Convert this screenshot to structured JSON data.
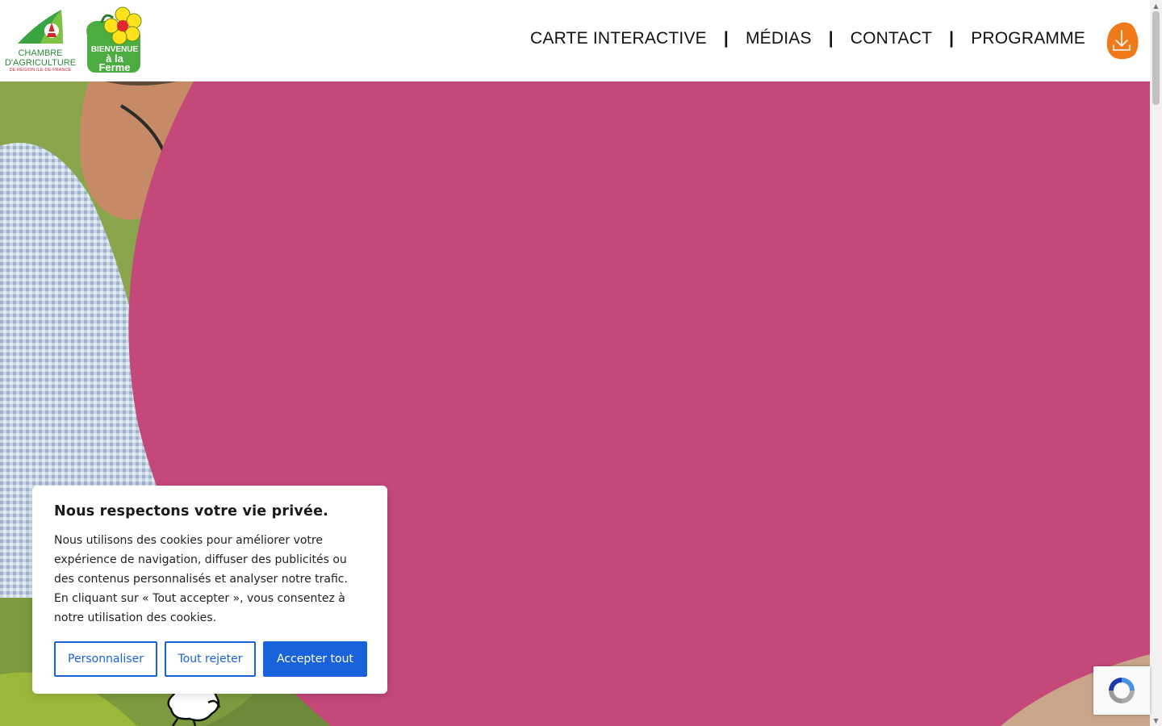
{
  "header": {
    "logo_chambre": {
      "line1": "CHAMBRE",
      "line2": "D'AGRICULTURE",
      "line3": "DE RÉGION ILE-DE-FRANCE"
    },
    "logo_bienvenue": {
      "line1": "BIENVENUE",
      "line2": "à la Ferme"
    },
    "nav": {
      "items": [
        {
          "label": "CARTE INTERACTIVE"
        },
        {
          "label": "MÉDIAS"
        },
        {
          "label": "CONTACT"
        },
        {
          "label": "PROGRAMME"
        }
      ],
      "separator": "|"
    },
    "download_icon": "download-icon"
  },
  "colors": {
    "hero_pink": "#c5487b",
    "accent_orange": "#f07a1a",
    "button_blue": "#1863dc",
    "brand_green": "#2a8a3a"
  },
  "cookie_banner": {
    "title": "Nous respectons votre vie privée.",
    "text": "Nous utilisons des cookies pour améliorer votre expérience de navigation, diffuser des publicités ou des contenus personnalisés et analyser notre trafic. En cliquant sur « Tout accepter », vous consentez à notre utilisation des cookies.",
    "buttons": {
      "customize": "Personnaliser",
      "reject": "Tout rejeter",
      "accept": "Accepter tout"
    }
  },
  "recaptcha": {
    "icon": "recaptcha-icon"
  }
}
